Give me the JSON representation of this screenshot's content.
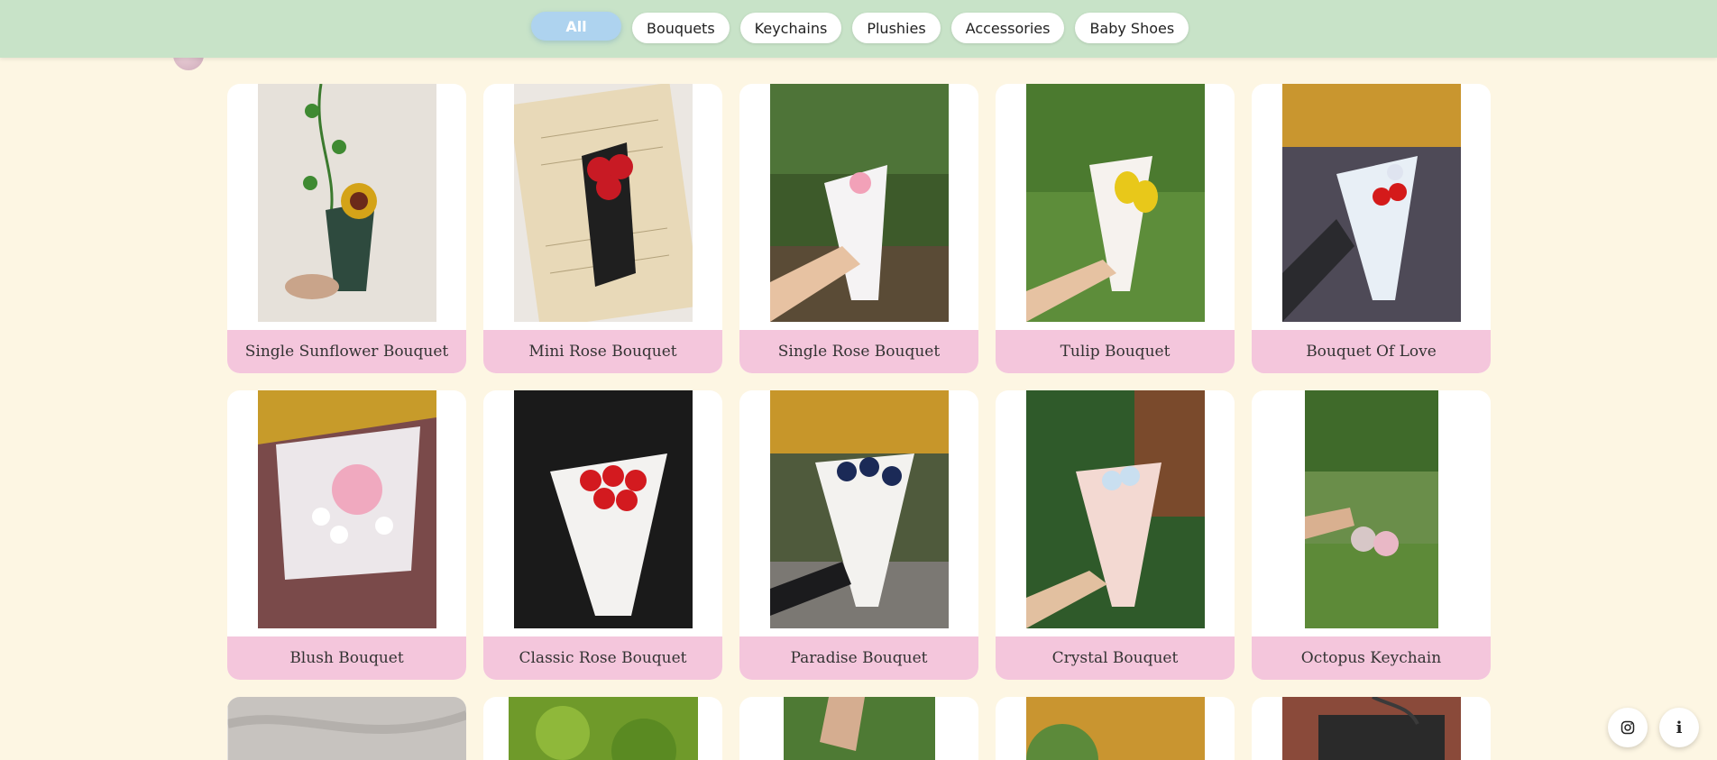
{
  "filters": [
    {
      "label": "All",
      "active": true
    },
    {
      "label": "Bouquets",
      "active": false
    },
    {
      "label": "Keychains",
      "active": false
    },
    {
      "label": "Plushies",
      "active": false
    },
    {
      "label": "Accessories",
      "active": false
    },
    {
      "label": "Baby Shoes",
      "active": false
    }
  ],
  "products": [
    {
      "name": "Single Sunflower Bouquet"
    },
    {
      "name": "Mini Rose Bouquet"
    },
    {
      "name": "Single Rose Bouquet"
    },
    {
      "name": "Tulip Bouquet"
    },
    {
      "name": "Bouquet Of Love"
    },
    {
      "name": "Blush Bouquet"
    },
    {
      "name": "Classic Rose Bouquet"
    },
    {
      "name": "Paradise Bouquet"
    },
    {
      "name": "Crystal Bouquet"
    },
    {
      "name": "Octopus Keychain"
    }
  ],
  "fabs": {
    "instagram_icon": "instagram-icon",
    "info_label": "i"
  },
  "colors": {
    "topbar": "#c8e3c8",
    "background": "#fdf6e3",
    "label_bg": "#f4c6dc",
    "active_pill": "#aed3ef"
  }
}
